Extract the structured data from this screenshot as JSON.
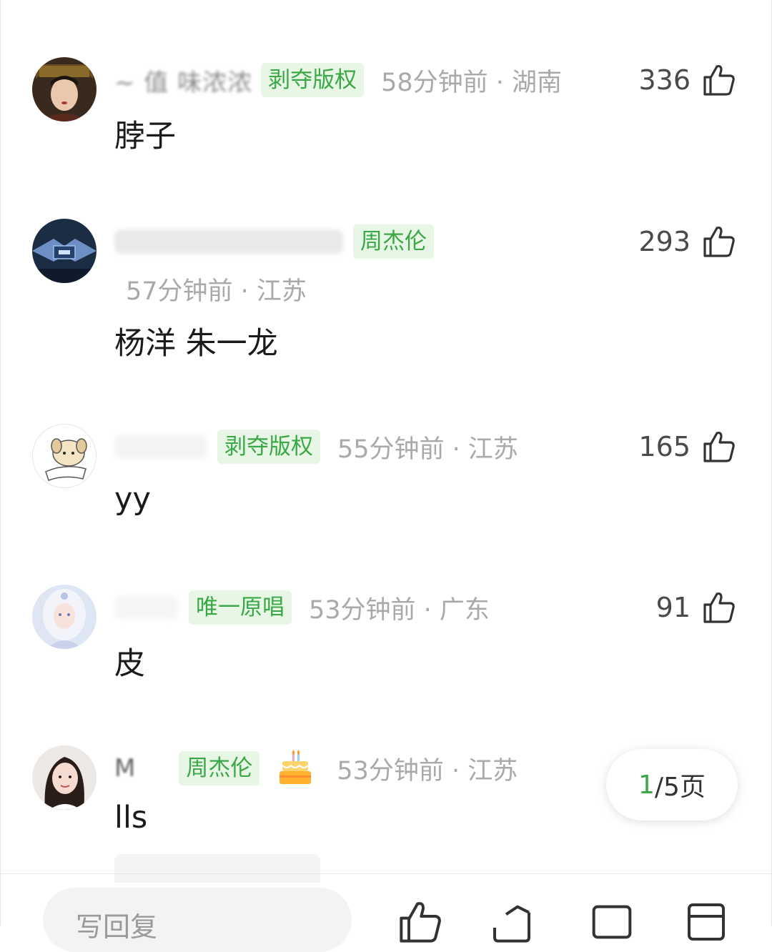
{
  "comments": [
    {
      "username": "~ 值 味浓浓",
      "badge": "剥夺版权",
      "time_location": "58分钟前 · 湖南",
      "likes": "336",
      "text": "脖子"
    },
    {
      "username": "",
      "badge": "周杰伦",
      "time_location": "57分钟前 · 江苏",
      "likes": "293",
      "text": "杨洋 朱一龙"
    },
    {
      "username": "",
      "badge": "剥夺版权",
      "time_location": "55分钟前 · 江苏",
      "likes": "165",
      "text": "yy"
    },
    {
      "username": "",
      "badge": "唯一原唱",
      "time_location": "53分钟前 · 广东",
      "likes": "91",
      "text": "皮"
    },
    {
      "username": "M",
      "badge": "周杰伦",
      "time_location": "53分钟前 · 江苏",
      "likes": "",
      "text": "lls"
    }
  ],
  "pager": {
    "current": "1",
    "total": "/5页"
  },
  "bottom_bar": {
    "reply_placeholder": "写回复"
  },
  "colors": {
    "badge_bg": "#e8f6e6",
    "badge_text": "#3aa847",
    "meta_gray": "#a9a9a9"
  }
}
